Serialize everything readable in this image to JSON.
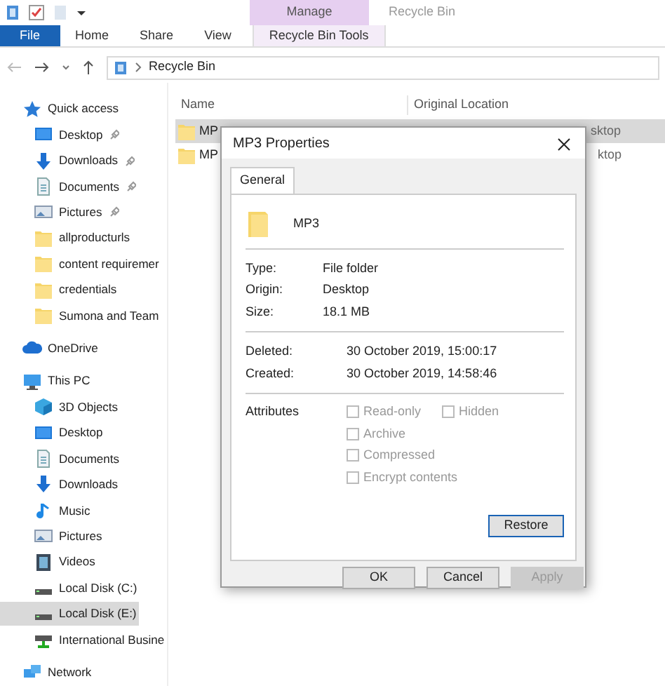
{
  "ribbon": {
    "context_group": "Manage",
    "window_title": "Recycle Bin",
    "tabs": [
      {
        "label": "File",
        "kind": "file",
        "selected": false
      },
      {
        "label": "Home",
        "kind": "tab",
        "selected": false
      },
      {
        "label": "Share",
        "kind": "tab",
        "selected": false
      },
      {
        "label": "View",
        "kind": "tab",
        "selected": false
      },
      {
        "label": "Recycle Bin Tools",
        "kind": "context",
        "selected": false
      }
    ]
  },
  "address_bar": {
    "path": "Recycle Bin"
  },
  "sidebar": {
    "items": [
      {
        "label": "Quick access",
        "kind": "star",
        "selected": false,
        "children": [
          {
            "label": "Desktop",
            "kind": "desktop",
            "pinned": true,
            "selected": false
          },
          {
            "label": "Downloads",
            "kind": "download",
            "pinned": true,
            "selected": false
          },
          {
            "label": "Documents",
            "kind": "document",
            "pinned": true,
            "selected": false
          },
          {
            "label": "Pictures",
            "kind": "pictures",
            "pinned": true,
            "selected": false
          },
          {
            "label": "allproducturls",
            "kind": "folder",
            "pinned": false,
            "selected": false
          },
          {
            "label": "content requiremer",
            "kind": "folder",
            "pinned": false,
            "selected": false
          },
          {
            "label": "credentials",
            "kind": "folder",
            "pinned": false,
            "selected": false
          },
          {
            "label": "Sumona and Team",
            "kind": "folder",
            "pinned": false,
            "selected": false
          }
        ]
      },
      {
        "label": "OneDrive",
        "kind": "cloud",
        "selected": false
      },
      {
        "label": "This PC",
        "kind": "pc",
        "selected": false,
        "children": [
          {
            "label": "3D Objects",
            "kind": "cube",
            "selected": false
          },
          {
            "label": "Desktop",
            "kind": "desktop",
            "selected": false
          },
          {
            "label": "Documents",
            "kind": "document",
            "selected": false
          },
          {
            "label": "Downloads",
            "kind": "download",
            "selected": false
          },
          {
            "label": "Music",
            "kind": "music",
            "selected": false
          },
          {
            "label": "Pictures",
            "kind": "pictures",
            "selected": false
          },
          {
            "label": "Videos",
            "kind": "video",
            "selected": false
          },
          {
            "label": "Local Disk (C:)",
            "kind": "disk",
            "selected": false
          },
          {
            "label": "Local Disk (E:)",
            "kind": "disk",
            "selected": true
          },
          {
            "label": "International Busine",
            "kind": "netdrive",
            "selected": false
          }
        ]
      },
      {
        "label": "Network",
        "kind": "network",
        "selected": false
      }
    ]
  },
  "file_list": {
    "columns": [
      "Name",
      "Original Location"
    ],
    "rows": [
      {
        "name": "MP",
        "location": "sktop",
        "selected": true
      },
      {
        "name": "MP",
        "location": "ktop",
        "selected": false
      }
    ]
  },
  "dialog": {
    "title": "MP3 Properties",
    "tabs": [
      {
        "label": "General",
        "selected": true
      }
    ],
    "item_name": "MP3",
    "info": [
      {
        "label": "Type:",
        "value": "File folder"
      },
      {
        "label": "Origin:",
        "value": "Desktop"
      },
      {
        "label": "Size:",
        "value": "18.1 MB"
      }
    ],
    "dates": [
      {
        "label": "Deleted:",
        "value": "30 October 2019, 15:00:17"
      },
      {
        "label": "Created:",
        "value": "30 October 2019, 14:58:46"
      }
    ],
    "attributes_label": "Attributes",
    "attributes": [
      {
        "label": "Read-only",
        "checked": false,
        "disabled": true
      },
      {
        "label": "Hidden",
        "checked": false,
        "disabled": true
      },
      {
        "label": "Archive",
        "checked": false,
        "disabled": true
      },
      {
        "label": "Compressed",
        "checked": false,
        "disabled": true
      },
      {
        "label": "Encrypt contents",
        "checked": false,
        "disabled": true
      }
    ],
    "restore_button": "Restore",
    "buttons": [
      {
        "label": "OK",
        "disabled": false
      },
      {
        "label": "Cancel",
        "disabled": false
      },
      {
        "label": "Apply",
        "disabled": true
      }
    ]
  }
}
